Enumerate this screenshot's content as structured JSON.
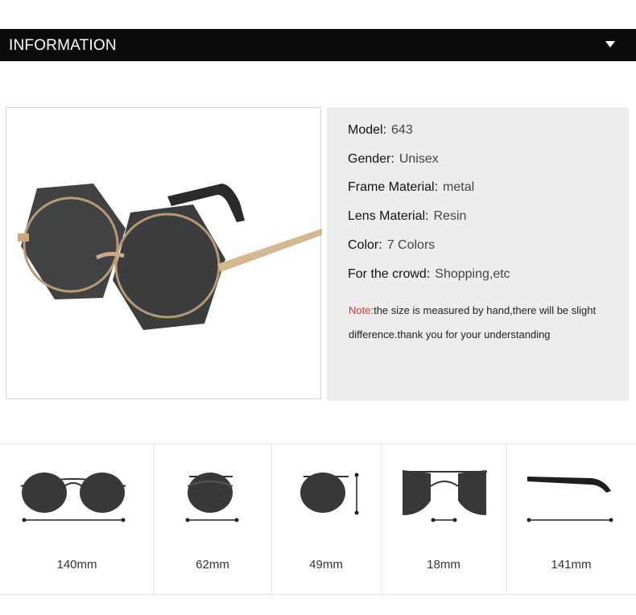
{
  "header": {
    "title": "INFORMATION"
  },
  "specs": {
    "model": {
      "label": "Model:",
      "value": "643"
    },
    "gender": {
      "label": "Gender:",
      "value": "Unisex"
    },
    "frame_material": {
      "label": "Frame Material:",
      "value": "metal"
    },
    "lens_material": {
      "label": "Lens Material:",
      "value": "Resin"
    },
    "color": {
      "label": "Color:",
      "value": "7 Colors"
    },
    "crowd": {
      "label": "For the crowd:",
      "value": "Shopping,etc"
    }
  },
  "note": {
    "label": "Note:",
    "text": "the size is measured by hand,there will be slight difference.thank you for your understanding"
  },
  "dimensions": [
    {
      "label": "140mm"
    },
    {
      "label": "62mm"
    },
    {
      "label": "49mm"
    },
    {
      "label": "18mm"
    },
    {
      "label": "141mm"
    }
  ],
  "colors": {
    "header_bg": "#0c0c0c",
    "panel_bg": "#eeeded",
    "note_accent": "#e0342c",
    "lens": "#3a3b3d"
  }
}
